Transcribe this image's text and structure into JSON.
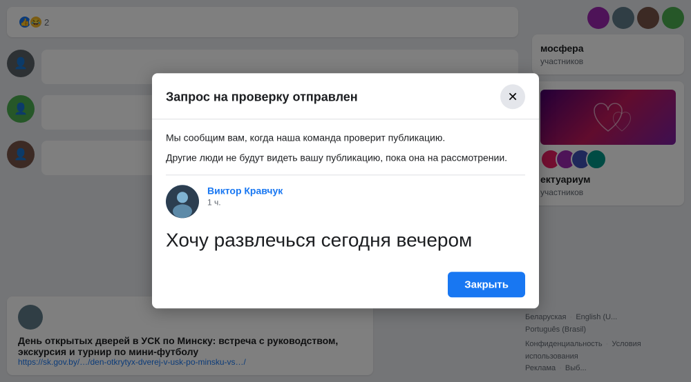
{
  "background": {
    "feed_items": [
      {
        "type": "reactions",
        "like_count": "2",
        "haha_count": ""
      },
      {
        "type": "user_post",
        "avatar_color": "dark",
        "name": "",
        "text": ""
      },
      {
        "type": "user_post",
        "avatar_color": "green",
        "name": "",
        "text": ""
      },
      {
        "type": "user_post",
        "avatar_color": "brown",
        "name": "",
        "text": ""
      }
    ],
    "bottom_post": {
      "user_avatar_color": "blue-grey",
      "title": "День открытых дверей в УСК по Минску: встреча с руководством, экскурсия и турнир по мини-футболу",
      "link": "https://sk.gov.by/…/den-otkrytyx-dverej-v-usk-po-minsku-vs…/"
    }
  },
  "sidebar": {
    "group1": {
      "title": "мосфера",
      "subtitle": "участников"
    },
    "group2": {
      "title": "ектуариум",
      "subtitle": "участников"
    }
  },
  "footer": {
    "languages": [
      "Беларуская",
      "English (U...",
      "Português (Brasil)"
    ],
    "links": [
      "Конфиденциальность",
      "Условия использования",
      "Реклама",
      "Выб..."
    ],
    "english_label": "English"
  },
  "modal": {
    "title": "Запрос на проверку отправлен",
    "close_aria": "Закрыть диалог",
    "info_line1": "Мы сообщим вам, когда наша команда проверит публикацию.",
    "info_line2": "Другие люди не будут видеть вашу публикацию, пока она на рассмотрении.",
    "post": {
      "author": "Виктор Кравчук",
      "time": "1 ч.",
      "content": "Хочу развлечься сегодня вечером"
    },
    "close_button_label": "Закрыть"
  }
}
